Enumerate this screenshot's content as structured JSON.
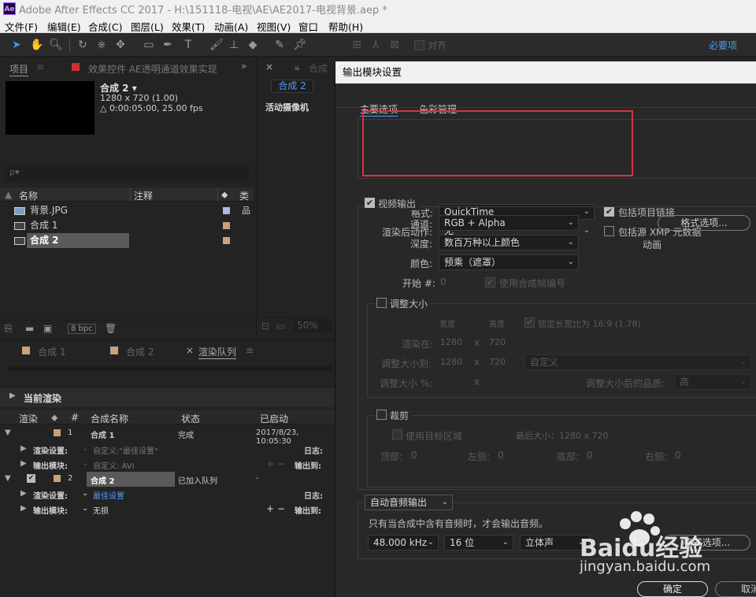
{
  "window": {
    "app_icon": "Ae",
    "title": "Adobe After Effects CC 2017 - H:\\151118-电视\\AE\\AE2017-电视背景.aep *"
  },
  "menu": [
    "文件(F)",
    "编辑(E)",
    "合成(C)",
    "图层(L)",
    "效果(T)",
    "动画(A)",
    "视图(V)",
    "窗口",
    "帮助(H)"
  ],
  "toolbar": {
    "align_label": "对齐",
    "workspace": "必要项"
  },
  "project_panel": {
    "tab_project": "项目",
    "tab_effects": "效果控件 AE透明通道效果实现",
    "comp_name": "合成 2 ▾",
    "comp_size": "1280 x 720 (1.00)",
    "comp_duration": "△ 0:00:05:00, 25.00 fps",
    "search_placeholder": "ρ▾",
    "col_name": "名称",
    "col_comment": "注释",
    "col_type": "类",
    "items": [
      {
        "name": "背景.JPG",
        "color": "#b9b3e0"
      },
      {
        "name": "合成 1",
        "color": "#c8a27a"
      },
      {
        "name": "合成 2",
        "color": "#c8a27a"
      }
    ],
    "bpc": "8 bpc"
  },
  "viewer": {
    "tab_label": "合成 2",
    "active_camera": "活动摄像机",
    "zoom": "50%",
    "close": "×",
    "tab_prefix": "合成"
  },
  "timeline": {
    "tabs": [
      "合成 1",
      "合成 2",
      "渲染队列"
    ],
    "current_render": "当前渲染",
    "headers": {
      "render": "渲染",
      "num": "#",
      "comp_name": "合成名称",
      "status": "状态",
      "started": "已启动"
    },
    "items": [
      {
        "num": "1",
        "name": "合成 1",
        "status": "完成",
        "started": "2017/8/23, 10:05:30",
        "render_settings_label": "渲染设置:",
        "render_settings_value": "自定义:\"最佳设置\"",
        "output_module_label": "输出模块:",
        "output_module_value": "自定义: AVI",
        "log_label": "日志:",
        "output_to_label": "输出到:"
      },
      {
        "num": "2",
        "name": "合成 2",
        "status": "已加入队列",
        "started": "-",
        "render_settings_label": "渲染设置:",
        "render_settings_value": "最佳设置",
        "output_module_label": "输出模块:",
        "output_module_value": "无损",
        "log_label": "日志:",
        "output_to_label": "输出到:"
      }
    ]
  },
  "dialog": {
    "title": "输出模块设置",
    "tab_main": "主要选项",
    "tab_color": "色彩管理",
    "format_label": "格式:",
    "format_value": "QuickTime",
    "include_project_link": "包括项目链接",
    "post_render_label": "渲染后动作:",
    "post_render_value": "无",
    "include_xmp": "包括源 XMP 元数据",
    "video_output": "视频输出",
    "channels_label": "通道:",
    "channels_value": "RGB + Alpha",
    "depth_label": "深度:",
    "depth_value": "数百万种以上颜色",
    "color_label": "颜色:",
    "color_value": "预乘（遮罩）",
    "format_options": "格式选项...",
    "codec_text": "动画",
    "start_label": "开始 #:",
    "start_value": "0",
    "use_comp_frame": "使用合成帧编号",
    "resize": "调整大小",
    "width_hdr": "宽度",
    "height_hdr": "高度",
    "lock_aspect": "锁定长宽比为 16:9 (1.78)",
    "render_at_label": "渲染在:",
    "render_at_w": "1280",
    "render_at_h": "720",
    "resize_to_label": "调整大小到:",
    "resize_to_w": "1280",
    "resize_to_h": "720",
    "resize_custom": "自定义",
    "resize_pct_label": "调整大小 %:",
    "x": "x",
    "resize_quality_label": "调整大小后的品质:",
    "resize_quality_value": "高",
    "crop": "裁剪",
    "use_roi": "使用目标区域",
    "final_size": "最后大小：1280 x 720",
    "top_label": "顶部:",
    "top": "0",
    "left_label": "左侧:",
    "left": "0",
    "bottom_label": "底部:",
    "bottom": "0",
    "right_label": "右侧:",
    "right": "0",
    "audio_output": "自动音频输出",
    "audio_note": "只有当合成中含有音频时，才会输出音频。",
    "sample_rate": "48.000 kHz",
    "bit_depth": "16 位",
    "channels_audio": "立体声",
    "audio_format_options": "格式选项...",
    "ok": "确定",
    "cancel": "取消"
  },
  "watermark": {
    "brand": "Baidu经验",
    "url": "jingyan.baidu.com"
  }
}
